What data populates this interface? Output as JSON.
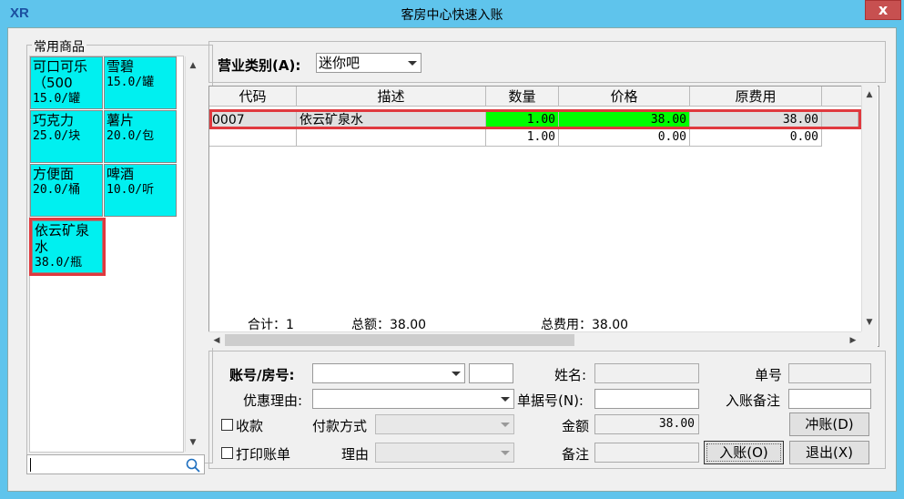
{
  "window": {
    "title": "客房中心快速入账",
    "close_glyph": "x"
  },
  "left_panel": {
    "group_title": "常用商品",
    "tiles": [
      {
        "name": "可口可乐（500",
        "price": "15.0/罐",
        "selected": false
      },
      {
        "name": "雪碧",
        "price": "15.0/罐",
        "selected": false
      },
      {
        "name": "巧克力",
        "price": "25.0/块",
        "selected": false
      },
      {
        "name": "薯片",
        "price": "20.0/包",
        "selected": false
      },
      {
        "name": "方便面",
        "price": "20.0/桶",
        "selected": false
      },
      {
        "name": "啤酒",
        "price": "10.0/听",
        "selected": false
      },
      {
        "name": "依云矿泉水",
        "price": "38.0/瓶",
        "selected": true
      }
    ],
    "search_placeholder": ""
  },
  "business_type": {
    "label": "营业类别(A):",
    "value": "迷你吧"
  },
  "grid": {
    "columns": [
      "代码",
      "描述",
      "数量",
      "价格",
      "原费用"
    ],
    "rows": [
      {
        "code": "0007",
        "desc": "依云矿泉水",
        "qty": "1.00",
        "price": "38.00",
        "cost": "38.00"
      },
      {
        "code": "",
        "desc": "",
        "qty": "1.00",
        "price": "0.00",
        "cost": "0.00"
      }
    ],
    "footer": {
      "count": "合计：1",
      "total": "总额：38.00",
      "total_cost": "总费用：38.00"
    }
  },
  "form": {
    "account_label": "账号/房号:",
    "account_value": "",
    "name_label": "姓名:",
    "name_value": "",
    "order_no_label": "单号",
    "order_no_value": "",
    "discount_label": "优惠理由:",
    "discount_value": "",
    "receipt_label": "单据号(N):",
    "receipt_value": "",
    "remark_entry_label": "入账备注",
    "remark_entry_value": "",
    "collect_label": "收款",
    "pay_method_label": "付款方式",
    "pay_method_value": "",
    "amount_label": "金额",
    "amount_value": "38.00",
    "print_label": "打印账单",
    "reason_label": "理由",
    "reason_value": "",
    "note_label": "备注",
    "note_value": ""
  },
  "buttons": {
    "reverse": "冲账(D)",
    "post": "入账(O)",
    "exit": "退出(X)"
  },
  "colors": {
    "tile": "#00f0f0",
    "highlight_green": "#00ff00",
    "selection_red": "#e0393e",
    "titlebar": "#5fc4ec"
  }
}
